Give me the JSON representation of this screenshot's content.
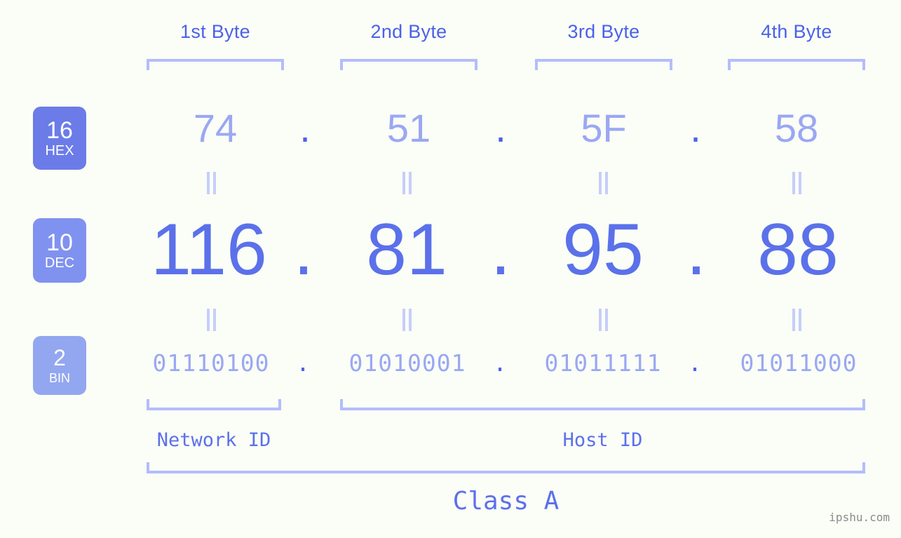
{
  "meta": {
    "background_color": "#fbfdf7",
    "accent_color": "#5b71ea",
    "light_accent_color": "#9aa8f2",
    "bracket_color": "#b3bdfb",
    "watermark": "ipshu.com"
  },
  "headers": {
    "bytes": [
      {
        "label": "1st Byte"
      },
      {
        "label": "2nd Byte"
      },
      {
        "label": "3rd Byte"
      },
      {
        "label": "4th Byte"
      }
    ]
  },
  "bases": [
    {
      "key": "hex",
      "number": "16",
      "name": "HEX",
      "color": "#6b7ce8"
    },
    {
      "key": "dec",
      "number": "10",
      "name": "DEC",
      "color": "#8092ef"
    },
    {
      "key": "bin",
      "number": "2",
      "name": "BIN",
      "color": "#93a6f0"
    }
  ],
  "separator": ".",
  "rows": {
    "hex": {
      "values": [
        "74",
        "51",
        "5F",
        "58"
      ]
    },
    "dec": {
      "values": [
        "116",
        "81",
        "95",
        "88"
      ]
    },
    "bin": {
      "values": [
        "01110100",
        "01010001",
        "01011111",
        "01011000"
      ]
    }
  },
  "segments": {
    "network_id": "Network ID",
    "host_id": "Host ID",
    "class": "Class A"
  }
}
